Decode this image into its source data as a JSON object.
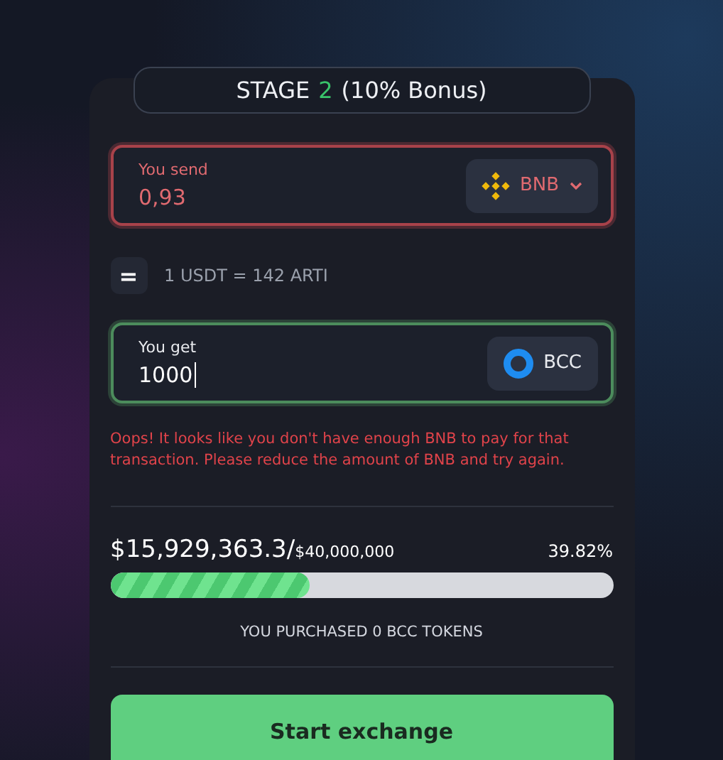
{
  "stage": {
    "label": "STAGE",
    "number": "2",
    "bonus": "(10% Bonus)"
  },
  "fields": [
    {
      "label": "You send",
      "value": "0,93",
      "error": true,
      "valid": false,
      "token": {
        "symbol": "BNB",
        "kind": "bnb",
        "dropdown": true
      }
    },
    {
      "label": "You get",
      "value": "1000",
      "error": false,
      "valid": true,
      "token": {
        "symbol": "BCC",
        "kind": "bcc",
        "dropdown": false
      }
    }
  ],
  "rate": {
    "icon": "=",
    "text": "1 USDT = 142 ARTI"
  },
  "error": "Oops! It looks like you don't have enough BNB to pay for that transaction. Please reduce the amount of BNB and try again.",
  "progress": {
    "raised": "$15,929,363.3/",
    "goal": "$40,000,000",
    "percent": "39.82%",
    "level": 0.3982
  },
  "purchased": "YOU PURCHASED 0 BCC TOKENS",
  "button": "Start exchange"
}
